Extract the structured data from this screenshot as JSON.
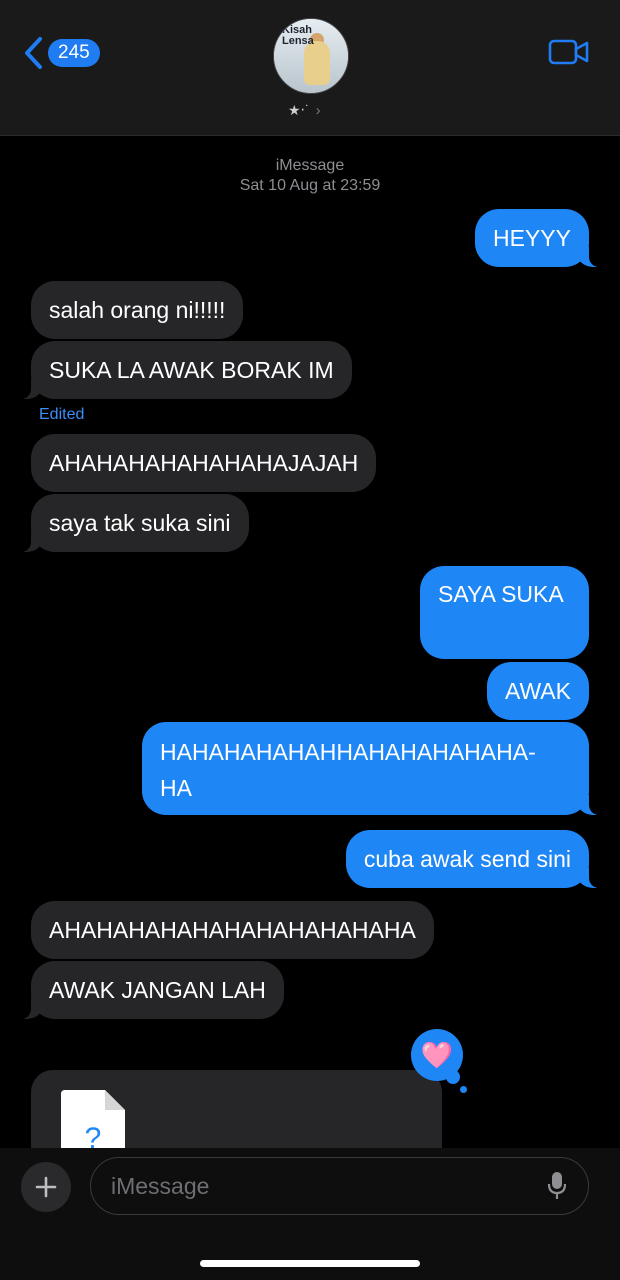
{
  "header": {
    "back_count": "245",
    "contact_brand_top": "Kisah",
    "contact_brand_bottom": "Lensa",
    "contact_sub": "★‧˙",
    "chevron": "›"
  },
  "thread": {
    "service": "iMessage",
    "date": "Sat 10 Aug at 23:59"
  },
  "messages": [
    {
      "dir": "out",
      "text": "HEYYY"
    },
    {
      "dir": "in",
      "text": "salah orang ni!!!!!"
    },
    {
      "dir": "in",
      "text": "SUKA LA AWAK BORAK IM"
    },
    {
      "dir": "in",
      "text": "AHAHAHAHAHAHAHAJAJAH"
    },
    {
      "dir": "in",
      "text": "saya tak suka sini"
    },
    {
      "dir": "out",
      "text": "SAYA SUKA"
    },
    {
      "dir": "out",
      "text": "AWAK"
    },
    {
      "dir": "out",
      "line1": "HAHAHAHAHAHHAHAHAHAHAHA-",
      "line2": "HA"
    },
    {
      "dir": "out",
      "text": "cuba awak send sini"
    },
    {
      "dir": "in",
      "text": "AHAHAHAHAHAHAHAHAHAHAHA"
    },
    {
      "dir": "in",
      "text": "AWAK JANGAN LAH"
    }
  ],
  "edited_label": "Edited",
  "tapback_icon": "pink-heart-icon",
  "tapback_glyph": "🩷",
  "file_placeholder_glyph": "?",
  "composer": {
    "placeholder": "iMessage"
  },
  "colors": {
    "outgoing": "#1e86f5",
    "incoming": "#262629",
    "edited": "#3b8ef5"
  }
}
